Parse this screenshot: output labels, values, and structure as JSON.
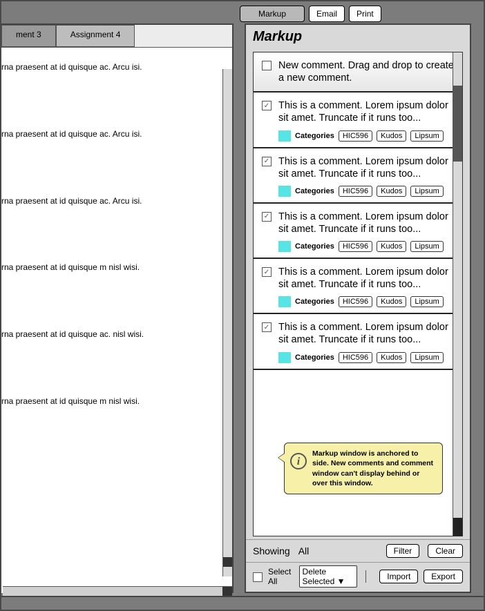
{
  "toolbar": {
    "markup": "Markup",
    "email": "Email",
    "print": "Print"
  },
  "tabs": {
    "t3": "ment 3",
    "t4": "Assignment 4"
  },
  "doc": {
    "p1": "rna praesent at id quisque ac. Arcu isi.",
    "p2": "rna praesent at id quisque ac. Arcu isi.",
    "p3": "rna praesent at id quisque ac. Arcu isi.",
    "p4": "rna praesent at id quisque m nisl wisi.",
    "p5": "rna praesent at id quisque ac. nisl wisi.",
    "p6": "rna praesent at id quisque m nisl wisi."
  },
  "panel": {
    "title": "Markup",
    "new_comment": "New comment. Drag and drop to create a new comment.",
    "comment_text": "This is a comment. Lorem ipsum dolor sit amet. Truncate if it runs too...",
    "categories_label": "Categories",
    "tags": {
      "a": "HIC596",
      "b": "Kudos",
      "c": "Lipsum"
    },
    "tooltip": "Markup window is anchored to side. New comments and comment window can't display behind or over this window.",
    "showing": "Showing",
    "all": "All",
    "filter": "Filter",
    "clear": "Clear",
    "select_all": "Select All",
    "delete_selected": "Delete Selected ▼",
    "import": "Import",
    "export": "Export"
  }
}
